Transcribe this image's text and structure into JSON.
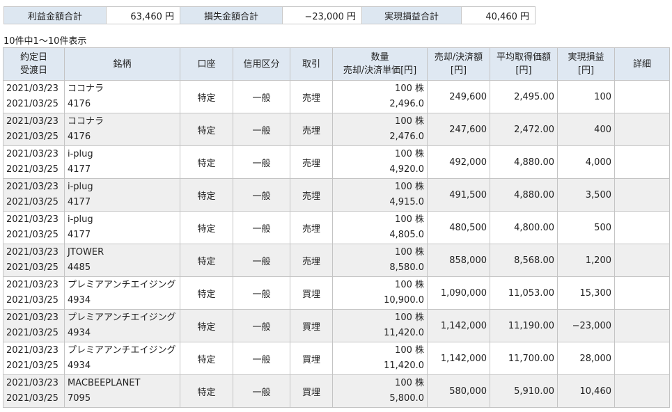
{
  "summary": {
    "profit_label": "利益金額合計",
    "profit_value": "63,460 円",
    "loss_label": "損失金額合計",
    "loss_value": "−23,000 円",
    "realized_label": "実現損益合計",
    "realized_value": "40,460 円"
  },
  "count_text": "10件中1～10件表示",
  "headers": {
    "date_top": "約定日",
    "date_bottom": "受渡日",
    "name": "銘柄",
    "account": "口座",
    "credit": "信用区分",
    "trade": "取引",
    "qty_top": "数量",
    "qty_bottom": "売却/決済単価[円]",
    "amount_top": "売却/決済額",
    "amount_bottom": "[円]",
    "avg_top": "平均取得価額",
    "avg_bottom": "[円]",
    "pl_top": "実現損益",
    "pl_bottom": "[円]",
    "detail": "詳細"
  },
  "rows": [
    {
      "trade_date": "2021/03/23",
      "settle_date": "2021/03/25",
      "name": "ココナラ",
      "code": "4176",
      "account": "特定",
      "credit": "一般",
      "type": "売埋",
      "qty": "100 株",
      "price": "2,496.0",
      "amount": "249,600",
      "avg": "2,495.00",
      "pl": "100",
      "detail": ""
    },
    {
      "trade_date": "2021/03/23",
      "settle_date": "2021/03/25",
      "name": "ココナラ",
      "code": "4176",
      "account": "特定",
      "credit": "一般",
      "type": "売埋",
      "qty": "100 株",
      "price": "2,476.0",
      "amount": "247,600",
      "avg": "2,472.00",
      "pl": "400",
      "detail": ""
    },
    {
      "trade_date": "2021/03/23",
      "settle_date": "2021/03/25",
      "name": "i-plug",
      "code": "4177",
      "account": "特定",
      "credit": "一般",
      "type": "売埋",
      "qty": "100 株",
      "price": "4,920.0",
      "amount": "492,000",
      "avg": "4,880.00",
      "pl": "4,000",
      "detail": ""
    },
    {
      "trade_date": "2021/03/23",
      "settle_date": "2021/03/25",
      "name": "i-plug",
      "code": "4177",
      "account": "特定",
      "credit": "一般",
      "type": "売埋",
      "qty": "100 株",
      "price": "4,915.0",
      "amount": "491,500",
      "avg": "4,880.00",
      "pl": "3,500",
      "detail": ""
    },
    {
      "trade_date": "2021/03/23",
      "settle_date": "2021/03/25",
      "name": "i-plug",
      "code": "4177",
      "account": "特定",
      "credit": "一般",
      "type": "売埋",
      "qty": "100 株",
      "price": "4,805.0",
      "amount": "480,500",
      "avg": "4,800.00",
      "pl": "500",
      "detail": ""
    },
    {
      "trade_date": "2021/03/23",
      "settle_date": "2021/03/25",
      "name": "JTOWER",
      "code": "4485",
      "account": "特定",
      "credit": "一般",
      "type": "売埋",
      "qty": "100 株",
      "price": "8,580.0",
      "amount": "858,000",
      "avg": "8,568.00",
      "pl": "1,200",
      "detail": ""
    },
    {
      "trade_date": "2021/03/23",
      "settle_date": "2021/03/25",
      "name": "プレミアアンチエイジング",
      "code": "4934",
      "account": "特定",
      "credit": "一般",
      "type": "買埋",
      "qty": "100 株",
      "price": "10,900.0",
      "amount": "1,090,000",
      "avg": "11,053.00",
      "pl": "15,300",
      "detail": ""
    },
    {
      "trade_date": "2021/03/23",
      "settle_date": "2021/03/25",
      "name": "プレミアアンチエイジング",
      "code": "4934",
      "account": "特定",
      "credit": "一般",
      "type": "買埋",
      "qty": "100 株",
      "price": "11,420.0",
      "amount": "1,142,000",
      "avg": "11,190.00",
      "pl": "−23,000",
      "detail": ""
    },
    {
      "trade_date": "2021/03/23",
      "settle_date": "2021/03/25",
      "name": "プレミアアンチエイジング",
      "code": "4934",
      "account": "特定",
      "credit": "一般",
      "type": "買埋",
      "qty": "100 株",
      "price": "11,420.0",
      "amount": "1,142,000",
      "avg": "11,700.00",
      "pl": "28,000",
      "detail": ""
    },
    {
      "trade_date": "2021/03/23",
      "settle_date": "2021/03/25",
      "name": "MACBEEPLANET",
      "code": "7095",
      "account": "特定",
      "credit": "一般",
      "type": "買埋",
      "qty": "100 株",
      "price": "5,800.0",
      "amount": "580,000",
      "avg": "5,910.00",
      "pl": "10,460",
      "detail": ""
    }
  ]
}
